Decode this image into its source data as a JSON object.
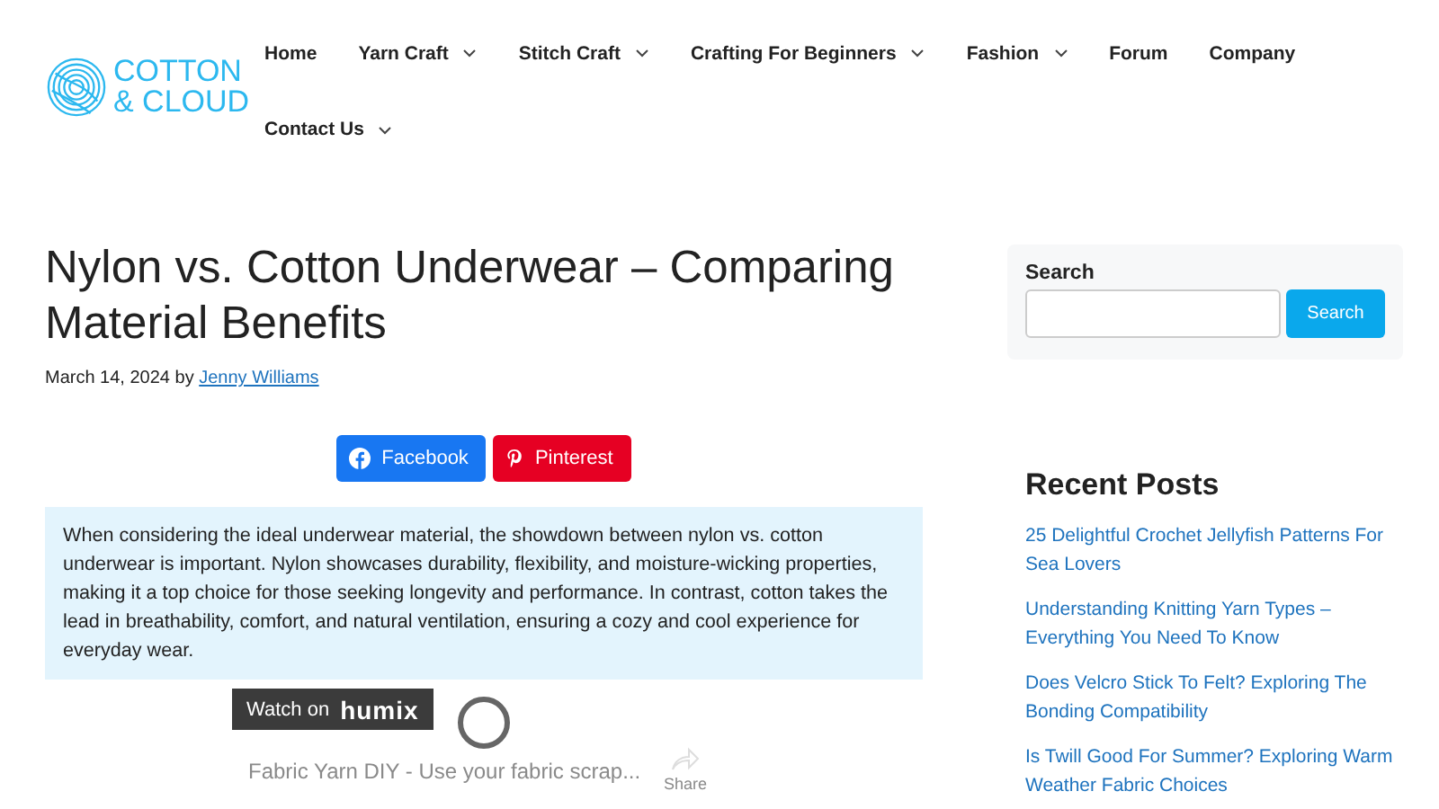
{
  "logo": {
    "line_1": "COTTON",
    "line_2": "& CLOUD"
  },
  "nav": [
    {
      "label": "Home",
      "dropdown": false
    },
    {
      "label": "Yarn Craft",
      "dropdown": true
    },
    {
      "label": "Stitch Craft",
      "dropdown": true
    },
    {
      "label": "Crafting For Beginners",
      "dropdown": true
    },
    {
      "label": "Fashion",
      "dropdown": true
    },
    {
      "label": "Forum",
      "dropdown": false
    },
    {
      "label": "Company",
      "dropdown": false
    },
    {
      "label": "Contact Us",
      "dropdown": true
    }
  ],
  "article": {
    "title": "Nylon vs. Cotton Underwear – Comparing Material Benefits",
    "date": "March 14, 2024",
    "by": "by",
    "author": "Jenny Williams",
    "share_buttons": [
      {
        "kind": "facebook",
        "label": "Facebook"
      },
      {
        "kind": "pinterest",
        "label": "Pinterest"
      }
    ],
    "summary": "When considering the ideal underwear material, the showdown between nylon vs. cotton underwear is important. Nylon showcases durability, flexibility, and moisture-wicking properties, making it a top choice for those seeking longevity and performance. In contrast, cotton takes the lead in breathability, comfort, and natural ventilation, ensuring a cozy and cool experience for everyday wear.",
    "video": {
      "watch_on": "Watch on",
      "brand": "humix",
      "title": "Fabric Yarn DIY - Use your fabric scrap...",
      "share": "Share"
    }
  },
  "sidebar": {
    "search": {
      "label": "Search",
      "button": "Search"
    },
    "recent_title": "Recent Posts",
    "recent_posts": [
      "25 Delightful Crochet Jellyfish Patterns For Sea Lovers",
      "Understanding Knitting Yarn Types – Everything You Need To Know",
      "Does Velcro Stick To Felt? Exploring The Bonding Compatibility",
      "Is Twill Good For Summer? Exploring Warm Weather Fabric Choices"
    ]
  }
}
